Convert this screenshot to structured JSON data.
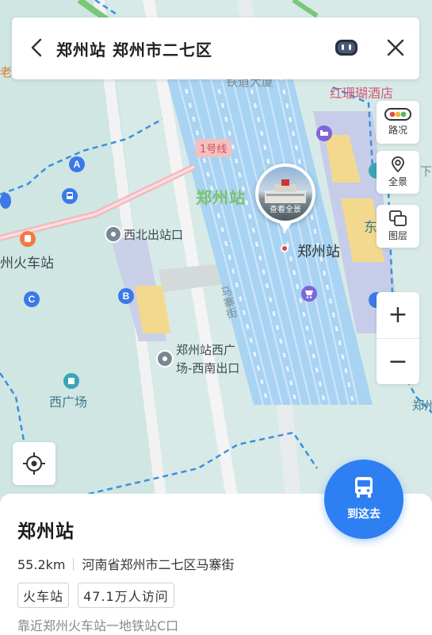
{
  "search": {
    "query": "郑州站 郑州市二七区"
  },
  "map": {
    "labels": {
      "hotel": "红珊瑚酒店",
      "building": "铁道大厦",
      "line1": "1号线",
      "station_area": "郑州站",
      "station_marker": "郑州站",
      "photo_caption": "查看全景",
      "northwest_exit": "西北出站口",
      "railway_station": "州火车站",
      "southwest_exit_line1": "郑州站西广",
      "southwest_exit_line2": "场-西南出口",
      "street": "马寨街",
      "west_square": "西广场",
      "east_partial": "东",
      "right_partial": "郑州",
      "top_left_partial": "老",
      "top_right_partial": "下"
    },
    "badges": {
      "a": "A",
      "b": "B",
      "c": "C"
    }
  },
  "tools": {
    "traffic": "路况",
    "panorama": "全景",
    "layers": "图层",
    "zoom_in": "+",
    "zoom_out": "−"
  },
  "panel": {
    "name": "郑州站",
    "distance": "55.2km",
    "address": "河南省郑州市二七区马寨街",
    "tags": [
      "火车站",
      "47.1万人访问"
    ],
    "nearby": "靠近郑州火车站一地铁站C口"
  },
  "goto": {
    "label": "到这去"
  },
  "colors": {
    "accent": "#2d7ff2",
    "map_bg": "#d7eae7",
    "tracks": "#a9d3f2",
    "metro_pink": "#f3c0c0"
  }
}
